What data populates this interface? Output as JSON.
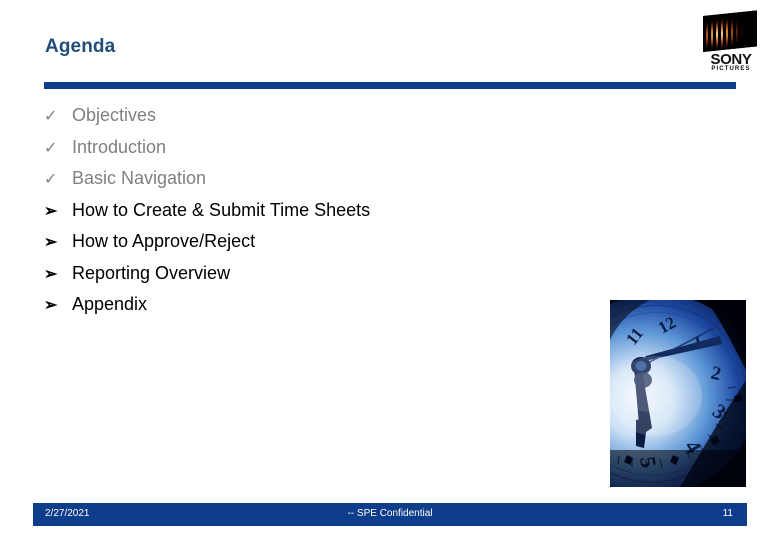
{
  "slide": {
    "title": "Agenda",
    "page_number": "11",
    "colors": {
      "title_text": "#1F4E79",
      "rule": "#0E3D8C",
      "footer_bar": "#0E3D8C",
      "completed_item": "#808080",
      "pending_item": "#000000"
    }
  },
  "logo": {
    "name": "sony-pictures-logo",
    "brand": "SONY",
    "sub_brand": "PICTURES"
  },
  "agenda": {
    "items": [
      {
        "bullet": "check-icon",
        "glyph": "✓",
        "label": "Objectives",
        "state": "done"
      },
      {
        "bullet": "check-icon",
        "glyph": "✓",
        "label": "Introduction",
        "state": "done"
      },
      {
        "bullet": "check-icon",
        "glyph": "✓",
        "label": "Basic Navigation",
        "state": "done"
      },
      {
        "bullet": "arrow-icon",
        "glyph": "➢",
        "label": "How to Create & Submit Time Sheets",
        "state": "todo"
      },
      {
        "bullet": "arrow-icon",
        "glyph": "➢",
        "label": "How to Approve/Reject",
        "state": "todo"
      },
      {
        "bullet": "arrow-icon",
        "glyph": "➢",
        "label": "Reporting Overview",
        "state": "todo"
      },
      {
        "bullet": "arrow-icon",
        "glyph": "➢",
        "label": "Appendix",
        "state": "todo"
      }
    ]
  },
  "clock_image": {
    "name": "clock-face-photo",
    "description": "Close-up photograph of a blue analog clock face",
    "visible_numerals": [
      "11",
      "12",
      "1",
      "2",
      "3",
      "4",
      "5"
    ]
  },
  "footer": {
    "date": "2/27/2021",
    "confidentiality": "-- SPE Confidential",
    "page": "11"
  }
}
